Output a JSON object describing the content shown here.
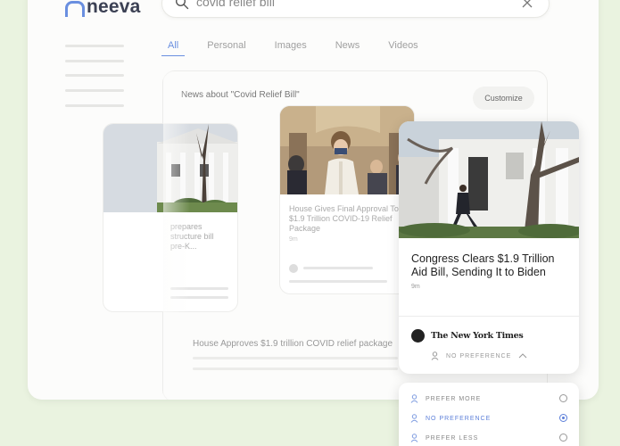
{
  "app": {
    "logo_text": "neeva"
  },
  "search": {
    "query": "covid relief bill"
  },
  "tabs": [
    {
      "label": "All",
      "active": true
    },
    {
      "label": "Personal"
    },
    {
      "label": "Images"
    },
    {
      "label": "News"
    },
    {
      "label": "Videos"
    }
  ],
  "news": {
    "heading": "News about \"Covid Relief Bill\"",
    "customize_label": "Customize",
    "cards": [
      {
        "lines": [
          "prepares",
          "structure bill",
          "pre-K..."
        ]
      },
      {
        "lines": [
          "House Gives Final Approval To",
          "$1.9 Trillion COVID-19 Relief",
          "Package"
        ],
        "time": "9m"
      }
    ],
    "list_item_title": "House Approves $1.9 trillion COVID relief package"
  },
  "featured": {
    "title": "Congress Clears $1.9 Trillion Aid Bill, Sending It to Biden",
    "time": "9m",
    "source": "The New York Times",
    "preference_label": "NO PREFERENCE"
  },
  "preference_menu": {
    "options": [
      {
        "label": "PREFER MORE",
        "selected": false
      },
      {
        "label": "NO PREFERENCE",
        "selected": true
      },
      {
        "label": "PREFER LESS",
        "selected": false
      }
    ]
  },
  "colors": {
    "accent": "#6a8fe0",
    "background": "#eaf3e0"
  }
}
